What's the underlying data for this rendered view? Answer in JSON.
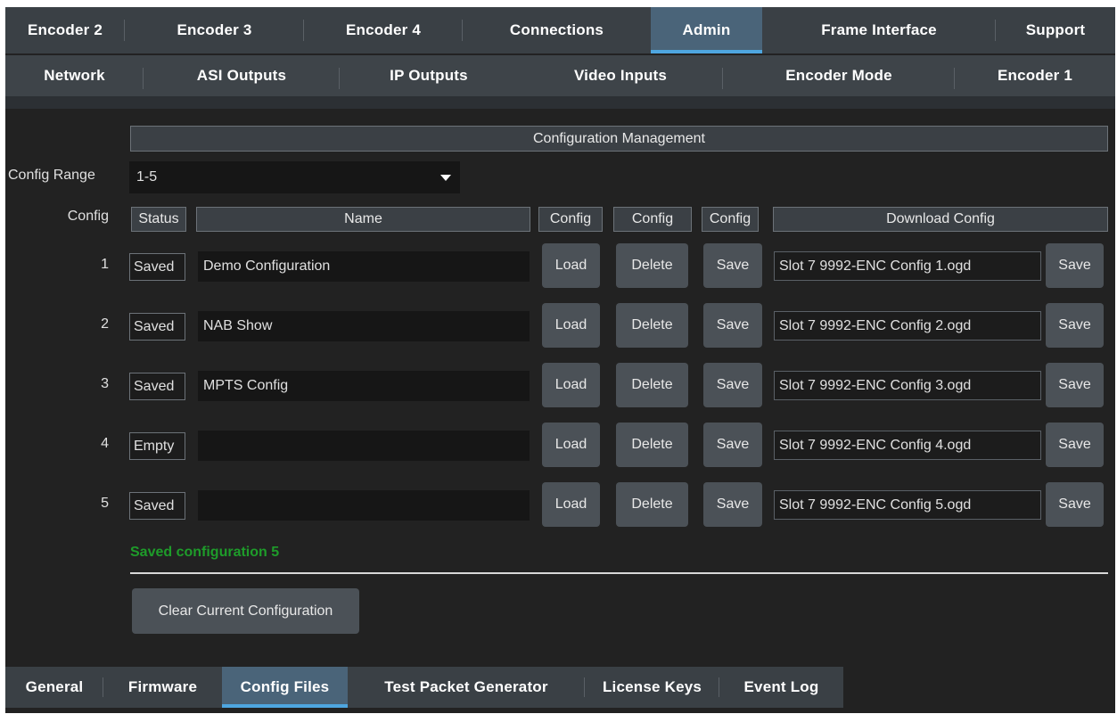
{
  "top_tabs": [
    {
      "label": "Encoder 2",
      "active": false
    },
    {
      "label": "Encoder 3",
      "active": false
    },
    {
      "label": "Encoder 4",
      "active": false
    },
    {
      "label": "Connections",
      "active": false
    },
    {
      "label": "Admin",
      "active": true
    },
    {
      "label": "Frame Interface",
      "active": false
    },
    {
      "label": "Support",
      "active": false
    }
  ],
  "second_tabs": [
    {
      "label": "Network"
    },
    {
      "label": "ASI Outputs"
    },
    {
      "label": "IP Outputs"
    },
    {
      "label": "Video Inputs"
    },
    {
      "label": "Encoder Mode"
    },
    {
      "label": "Encoder 1"
    }
  ],
  "panel": {
    "title": "Configuration Management",
    "config_range_label": "Config Range",
    "config_range_value": "1-5",
    "config_col_label": "Config",
    "headers": {
      "status": "Status",
      "name": "Name",
      "load": "Config",
      "delete": "Config",
      "save": "Config",
      "download": "Download Config"
    },
    "rows": [
      {
        "num": "1",
        "status": "Saved",
        "name": "Demo Configuration",
        "load": "Load",
        "delete": "Delete",
        "save": "Save",
        "file": "Slot 7 9992-ENC Config 1.ogd",
        "dl_save": "Save"
      },
      {
        "num": "2",
        "status": "Saved",
        "name": "NAB Show",
        "load": "Load",
        "delete": "Delete",
        "save": "Save",
        "file": "Slot 7 9992-ENC Config 2.ogd",
        "dl_save": "Save"
      },
      {
        "num": "3",
        "status": "Saved",
        "name": "MPTS Config",
        "load": "Load",
        "delete": "Delete",
        "save": "Save",
        "file": "Slot 7 9992-ENC Config 3.ogd",
        "dl_save": "Save"
      },
      {
        "num": "4",
        "status": "Empty",
        "name": "",
        "load": "Load",
        "delete": "Delete",
        "save": "Save",
        "file": "Slot 7 9992-ENC Config 4.ogd",
        "dl_save": "Save"
      },
      {
        "num": "5",
        "status": "Saved",
        "name": "",
        "load": "Load",
        "delete": "Delete",
        "save": "Save",
        "file": "Slot 7 9992-ENC Config 5.ogd",
        "dl_save": "Save"
      }
    ],
    "status_message": "Saved configuration 5",
    "clear_button": "Clear Current Configuration"
  },
  "bottom_tabs": [
    {
      "label": "General",
      "active": false
    },
    {
      "label": "Firmware",
      "active": false
    },
    {
      "label": "Config Files",
      "active": true
    },
    {
      "label": "Test Packet Generator",
      "active": false
    },
    {
      "label": "License Keys",
      "active": false
    },
    {
      "label": "Event Log",
      "active": false
    }
  ],
  "colors": {
    "active_tab_bg": "#4a6479",
    "active_tab_indicator": "#4ea6e0",
    "success_text": "#1e9c2a"
  }
}
